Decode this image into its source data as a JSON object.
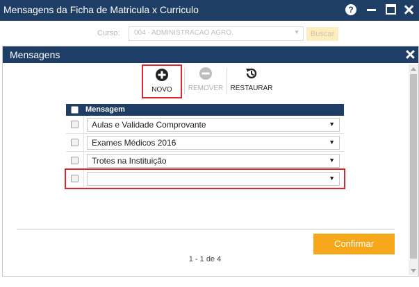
{
  "window": {
    "title": "Mensagens da Ficha de Matricula x Curriculo",
    "help_label": "?"
  },
  "filter": {
    "curso_label": "Curso:",
    "curso_value": "004 - ADMINISTRACAO AGRO.",
    "search_label": "Buscar"
  },
  "modal": {
    "title": "Mensagens",
    "toolbar": {
      "novo_label": "NOVO",
      "remover_label": "REMOVER",
      "restaurar_label": "RESTAURAR"
    },
    "grid": {
      "column_header": "Mensagem",
      "rows": [
        {
          "value": "Aulas e Validade Comprovante"
        },
        {
          "value": "Exames Médicos 2016"
        },
        {
          "value": "Trotes na Instituição"
        },
        {
          "value": ""
        }
      ],
      "pager": "1 - 1 de 4"
    },
    "confirm_label": "Confirmar"
  },
  "colors": {
    "header_blue": "#1e3e66",
    "accent_orange": "#f6a81a",
    "highlight_red": "#d9272e"
  }
}
